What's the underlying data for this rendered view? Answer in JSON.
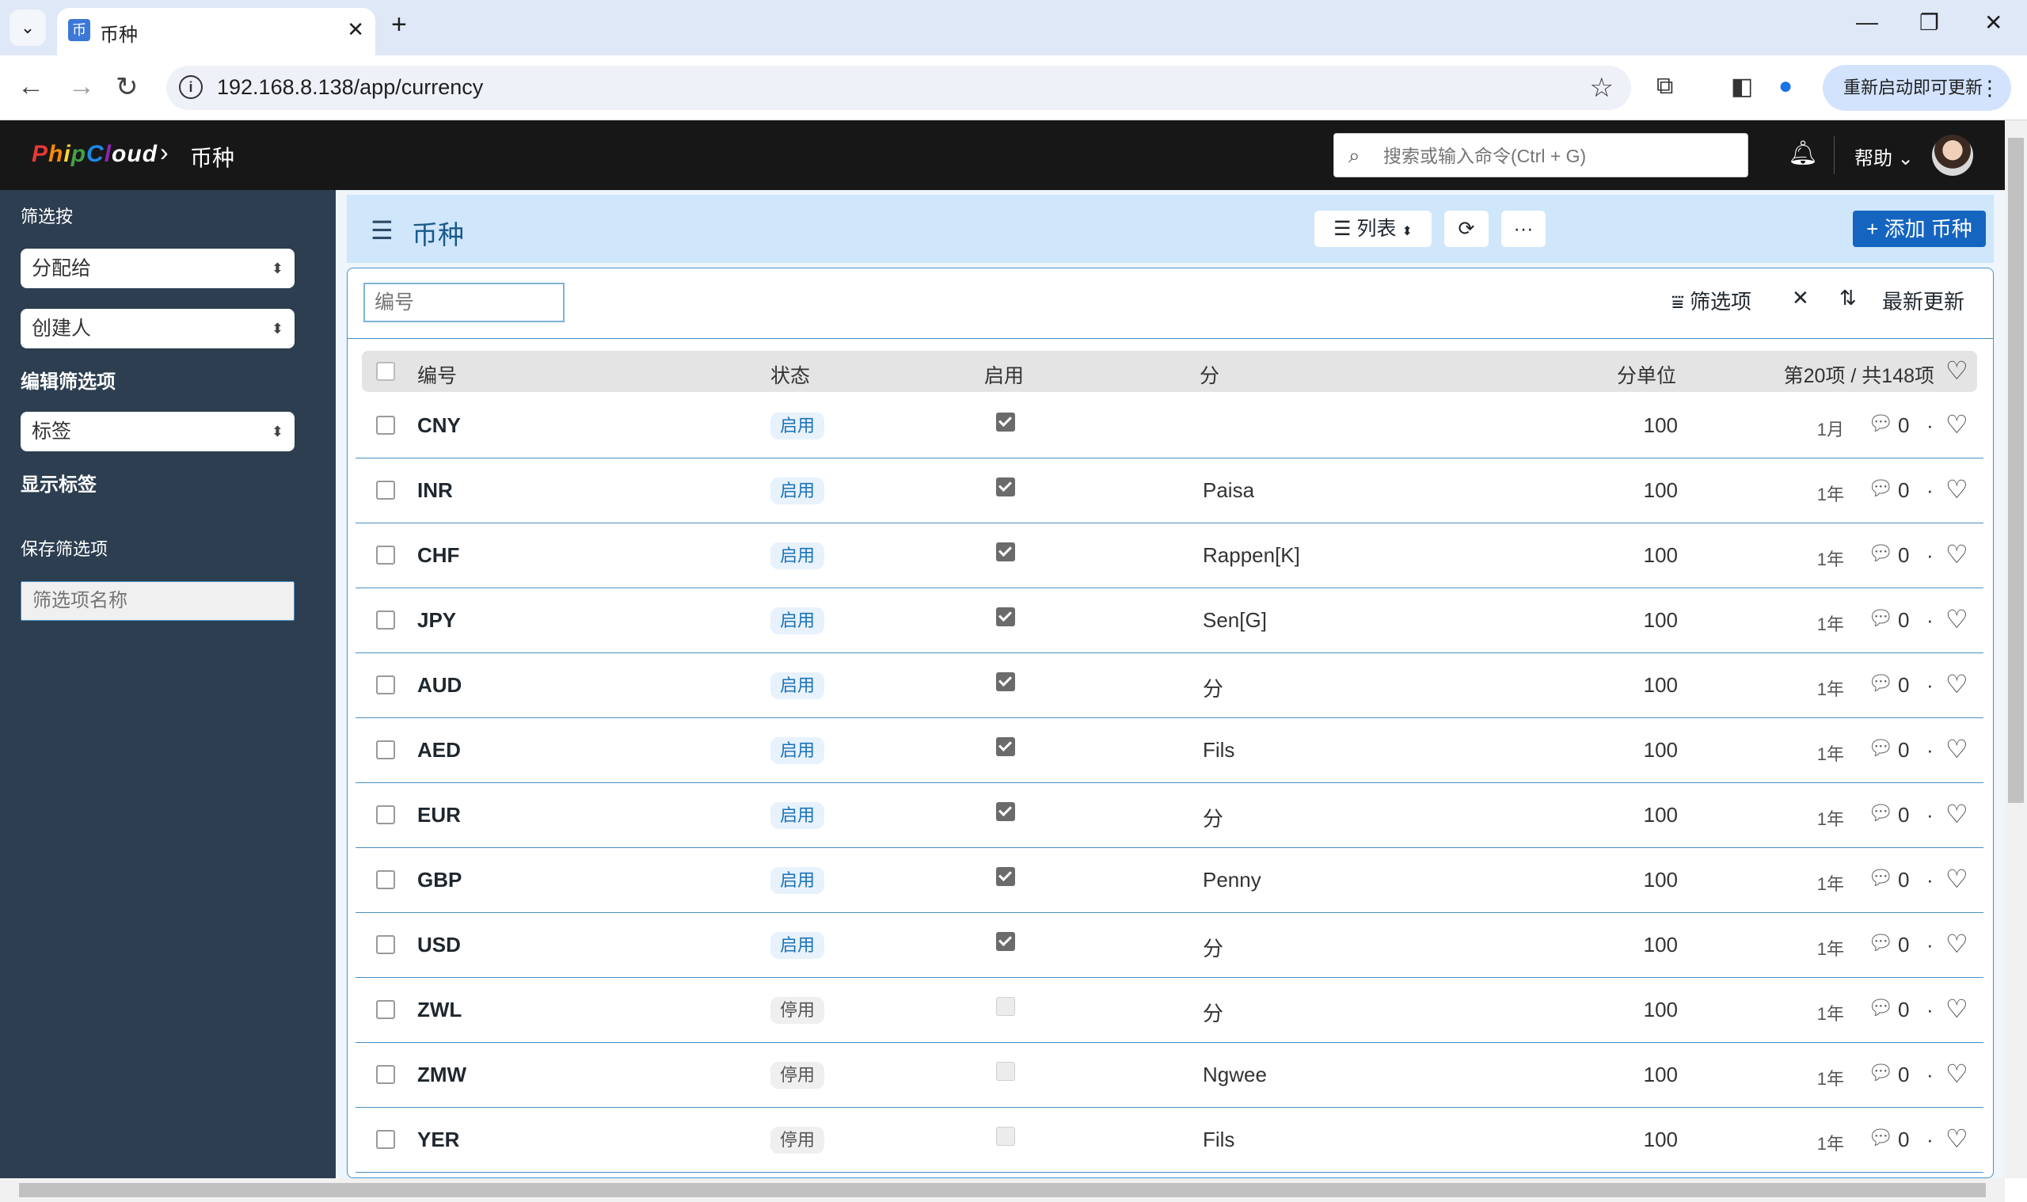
{
  "browser": {
    "tab_title": "币种",
    "url": "192.168.8.138/app/currency",
    "update_button": "重新启动即可更新"
  },
  "navbar": {
    "logo": "PhipCloud",
    "breadcrumb": "币种",
    "search_placeholder": "搜索或输入命令(Ctrl + G)",
    "help": "帮助"
  },
  "sidebar": {
    "filter_by": "筛选按",
    "assigned_to": "分配给",
    "created_by": "创建人",
    "edit_filters": "编辑筛选项",
    "tags": "标签",
    "show_tags": "显示标签",
    "save_filter": "保存筛选项",
    "filter_name_placeholder": "筛选项名称"
  },
  "page": {
    "title": "币种",
    "view_label": "列表",
    "more_label": "···",
    "add_label": "+ 添加 币种"
  },
  "filters": {
    "code_placeholder": "编号",
    "filter_label": "筛选项",
    "sort_label": "最新更新"
  },
  "table": {
    "columns": {
      "code": "编号",
      "status": "状态",
      "enabled": "启用",
      "fraction": "分",
      "fraction_units": "分单位",
      "count": "第20项 / 共148项"
    },
    "rows": [
      {
        "code": "CNY",
        "status": "启用",
        "enabled": true,
        "fraction": "",
        "units": "100",
        "time": "1月",
        "comments": "0"
      },
      {
        "code": "INR",
        "status": "启用",
        "enabled": true,
        "fraction": "Paisa",
        "units": "100",
        "time": "1年",
        "comments": "0"
      },
      {
        "code": "CHF",
        "status": "启用",
        "enabled": true,
        "fraction": "Rappen[K]",
        "units": "100",
        "time": "1年",
        "comments": "0"
      },
      {
        "code": "JPY",
        "status": "启用",
        "enabled": true,
        "fraction": "Sen[G]",
        "units": "100",
        "time": "1年",
        "comments": "0"
      },
      {
        "code": "AUD",
        "status": "启用",
        "enabled": true,
        "fraction": "分",
        "units": "100",
        "time": "1年",
        "comments": "0"
      },
      {
        "code": "AED",
        "status": "启用",
        "enabled": true,
        "fraction": "Fils",
        "units": "100",
        "time": "1年",
        "comments": "0"
      },
      {
        "code": "EUR",
        "status": "启用",
        "enabled": true,
        "fraction": "分",
        "units": "100",
        "time": "1年",
        "comments": "0"
      },
      {
        "code": "GBP",
        "status": "启用",
        "enabled": true,
        "fraction": "Penny",
        "units": "100",
        "time": "1年",
        "comments": "0"
      },
      {
        "code": "USD",
        "status": "启用",
        "enabled": true,
        "fraction": "分",
        "units": "100",
        "time": "1年",
        "comments": "0"
      },
      {
        "code": "ZWL",
        "status": "停用",
        "enabled": false,
        "fraction": "分",
        "units": "100",
        "time": "1年",
        "comments": "0"
      },
      {
        "code": "ZMW",
        "status": "停用",
        "enabled": false,
        "fraction": "Ngwee",
        "units": "100",
        "time": "1年",
        "comments": "0"
      },
      {
        "code": "YER",
        "status": "停用",
        "enabled": false,
        "fraction": "Fils",
        "units": "100",
        "time": "1年",
        "comments": "0"
      }
    ]
  },
  "colors": {
    "navbar": "#171717",
    "sidebar": "#2c3e50",
    "accent": "#1565c0",
    "header_band": "#cfe6fb"
  }
}
